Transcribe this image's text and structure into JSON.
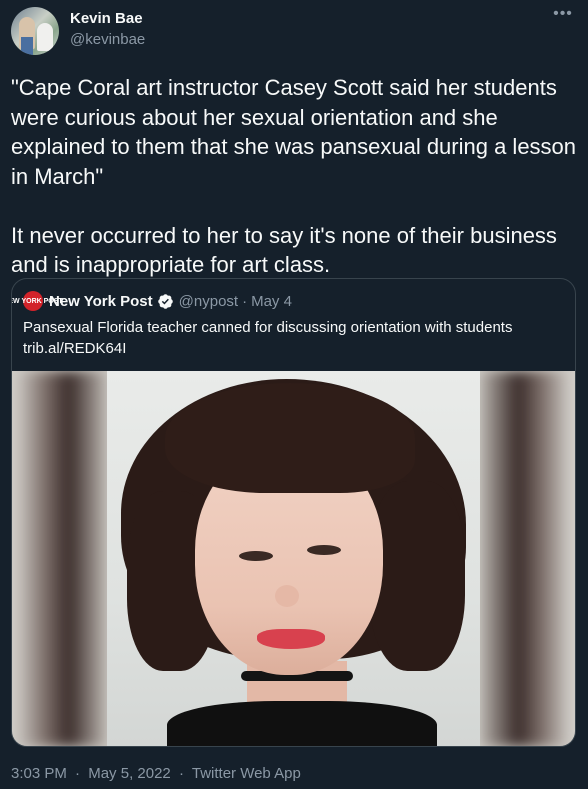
{
  "author": {
    "name": "Kevin Bae",
    "handle": "@kevinbae"
  },
  "more_label": "•••",
  "tweet": {
    "paragraph1": "\"Cape Coral art instructor Casey Scott said her students were curious about her sexual orientation and she explained to them that she was pansexual during a lesson in March\"",
    "paragraph2": "It never occurred to her to say it's none of their business and is inappropriate for art class."
  },
  "quote": {
    "logo_text": "NEW YORK POST",
    "name": "New York Post",
    "verified": true,
    "handle": "@nypost",
    "separator": "·",
    "date": "May 4",
    "text": "Pansexual Florida teacher canned for discussing orientation with students",
    "link": "trib.al/REDK64I"
  },
  "meta": {
    "time": "3:03 PM",
    "date": "May 5, 2022",
    "separator": "·",
    "source": "Twitter Web App"
  },
  "colors": {
    "background": "#15202b",
    "text": "#f7f9f9",
    "secondary": "#8b98a5",
    "border": "#38444d",
    "verified": "#1d9bf0",
    "nypost_red": "#d2232a"
  }
}
